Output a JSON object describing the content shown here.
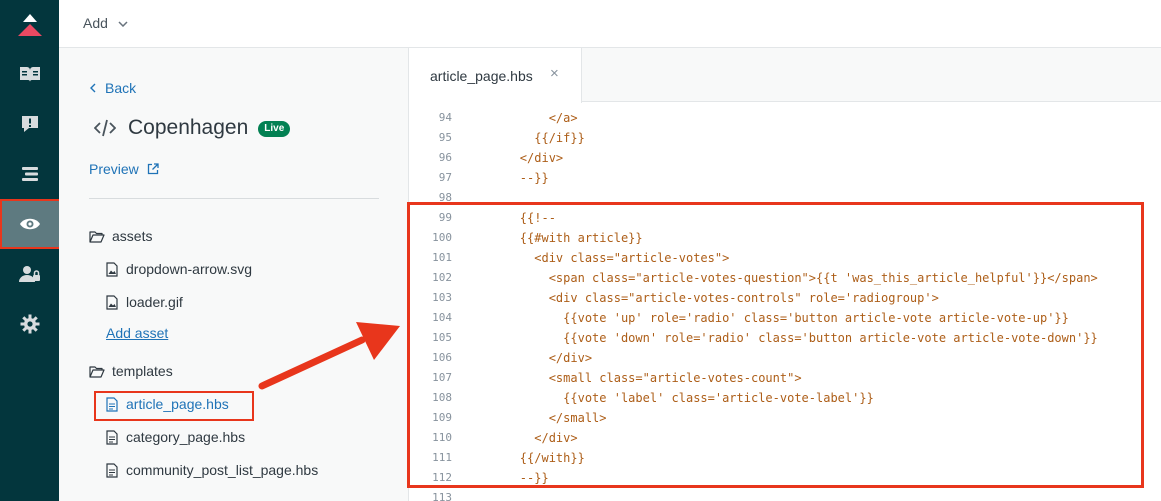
{
  "nav": {
    "items": [
      {
        "name": "guide-logo"
      },
      {
        "name": "knowledge-icon"
      },
      {
        "name": "moderation-icon"
      },
      {
        "name": "arrange-icon"
      },
      {
        "name": "customize-design-icon"
      },
      {
        "name": "user-permissions-icon"
      },
      {
        "name": "settings-icon"
      }
    ],
    "active": "customize-design-icon"
  },
  "topbar": {
    "add_label": "Add"
  },
  "panel": {
    "back_label": "Back",
    "theme_name": "Copenhagen",
    "live_badge": "Live",
    "preview_label": "Preview",
    "assets_folder": "assets",
    "asset_files": [
      "dropdown-arrow.svg",
      "loader.gif"
    ],
    "add_asset_label": "Add asset",
    "templates_folder": "templates",
    "template_files": [
      "article_page.hbs",
      "category_page.hbs",
      "community_post_list_page.hbs"
    ],
    "active_file": "article_page.hbs"
  },
  "editor": {
    "tab_label": "article_page.hbs",
    "tab_close": "×",
    "lines": [
      {
        "n": "94",
        "code": "            </a>"
      },
      {
        "n": "95",
        "code": "          {{/if}}"
      },
      {
        "n": "96",
        "code": "        </div>"
      },
      {
        "n": "97",
        "code": "        --}}"
      },
      {
        "n": "98",
        "code": ""
      },
      {
        "n": "99",
        "code": "        {{!--"
      },
      {
        "n": "100",
        "code": "        {{#with article}}"
      },
      {
        "n": "101",
        "code": "          <div class=\"article-votes\">"
      },
      {
        "n": "102",
        "code": "            <span class=\"article-votes-question\">{{t 'was_this_article_helpful'}}</span>"
      },
      {
        "n": "103",
        "code": "            <div class=\"article-votes-controls\" role='radiogroup'>"
      },
      {
        "n": "104",
        "code": "              {{vote 'up' role='radio' class='button article-vote article-vote-up'}}"
      },
      {
        "n": "105",
        "code": "              {{vote 'down' role='radio' class='button article-vote article-vote-down'}}"
      },
      {
        "n": "106",
        "code": "            </div>"
      },
      {
        "n": "107",
        "code": "            <small class=\"article-votes-count\">"
      },
      {
        "n": "108",
        "code": "              {{vote 'label' class='article-vote-label'}}"
      },
      {
        "n": "109",
        "code": "            </small>"
      },
      {
        "n": "110",
        "code": "          </div>"
      },
      {
        "n": "111",
        "code": "        {{/with}}"
      },
      {
        "n": "112",
        "code": "        --}}"
      },
      {
        "n": "113",
        "code": ""
      }
    ]
  },
  "colors": {
    "rail": "#03363d",
    "rail_active": "#5e7a80",
    "link": "#1f73b7",
    "live": "#038153",
    "highlight": "#e8361c",
    "code_text": "#ad5e18"
  }
}
